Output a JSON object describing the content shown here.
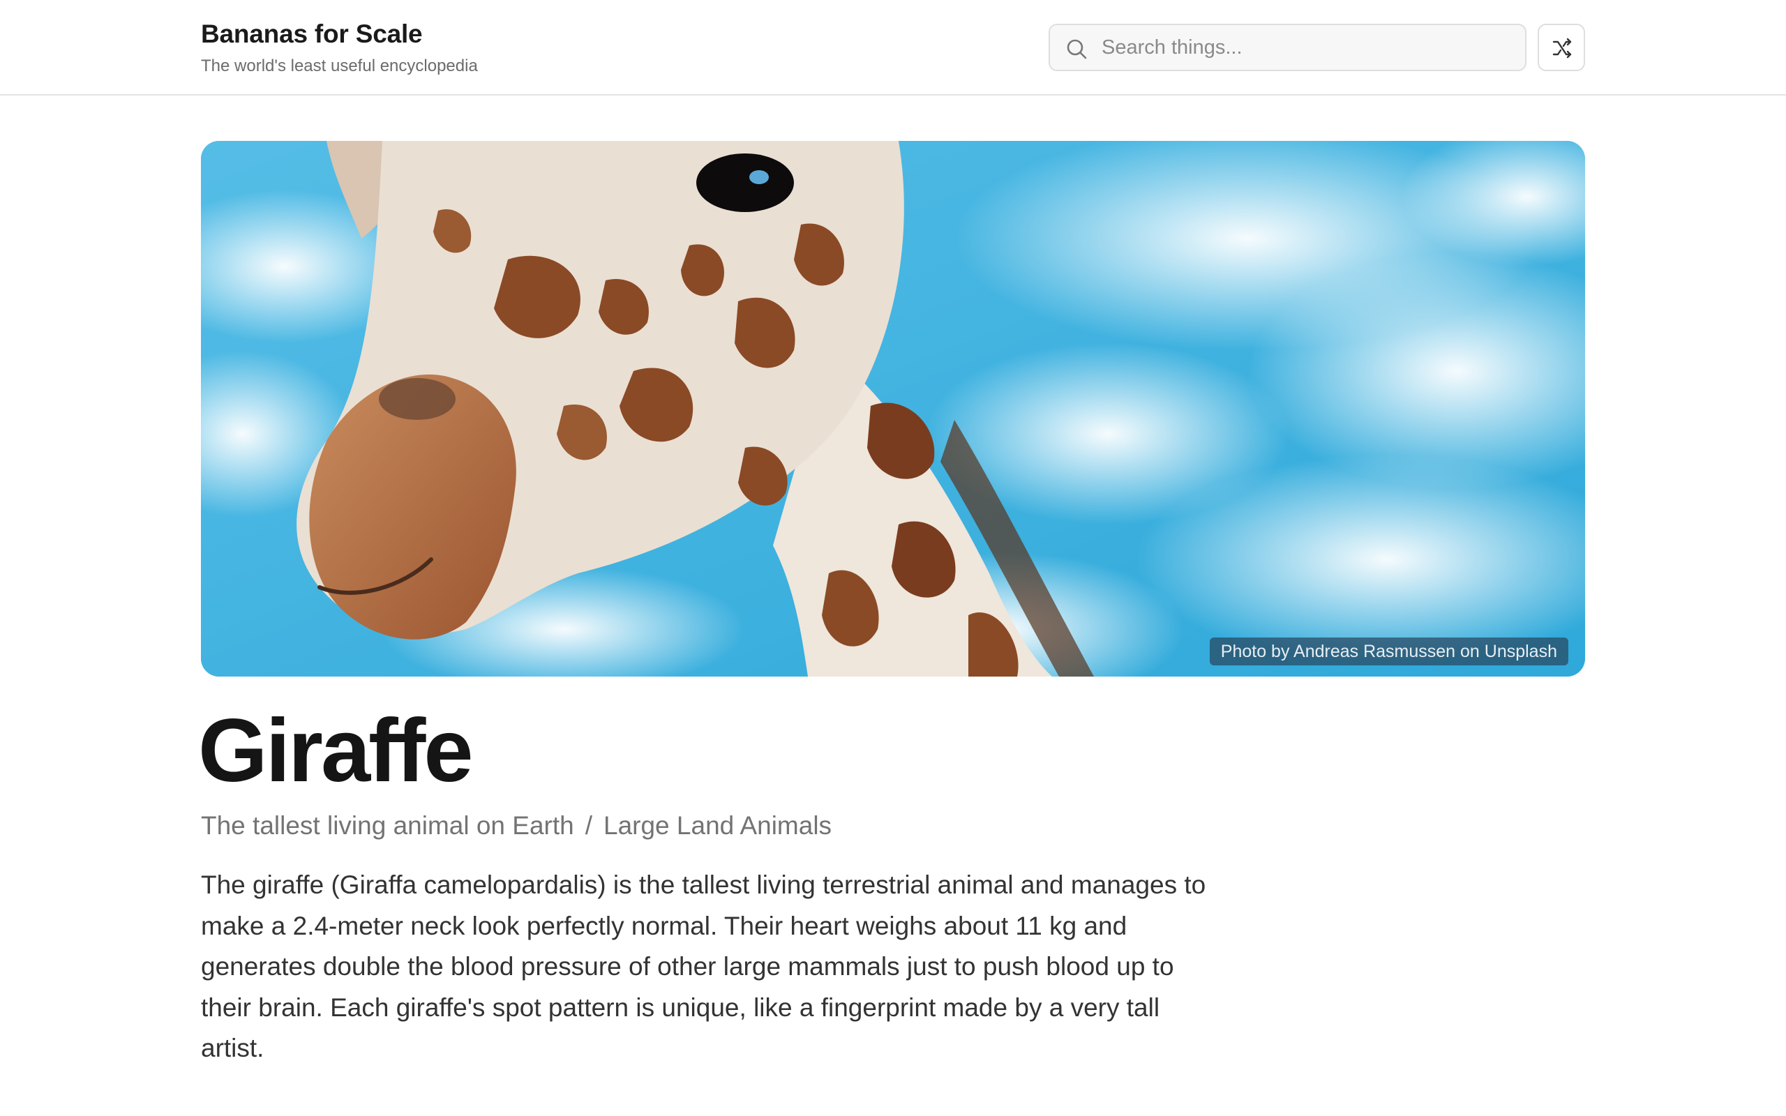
{
  "site": {
    "title": "Bananas for Scale",
    "tagline": "The world's least useful encyclopedia"
  },
  "search": {
    "placeholder": "Search things...",
    "value": ""
  },
  "icons": {
    "search": "search-icon",
    "shuffle": "shuffle-icon"
  },
  "hero": {
    "image": "giraffe head against blue cloudy sky",
    "credit": "Photo by Andreas Rasmussen on Unsplash"
  },
  "article": {
    "title": "Giraffe",
    "subtitle": "The tallest living animal on Earth",
    "separator": "/",
    "category": "Large Land Animals",
    "body": "The giraffe (Giraffa camelopardalis) is the tallest living terrestrial animal and manages to make a 2.4-meter neck look perfectly normal. Their heart weighs about 11 kg and generates double the blood pressure of other large mammals just to push blood up to their brain. Each giraffe's spot pattern is unique, like a fingerprint made by a very tall artist."
  },
  "colors": {
    "sky": "#3fb4e3",
    "spot": "#8a4a26",
    "text": "#1a1a1a",
    "muted": "#737373"
  }
}
